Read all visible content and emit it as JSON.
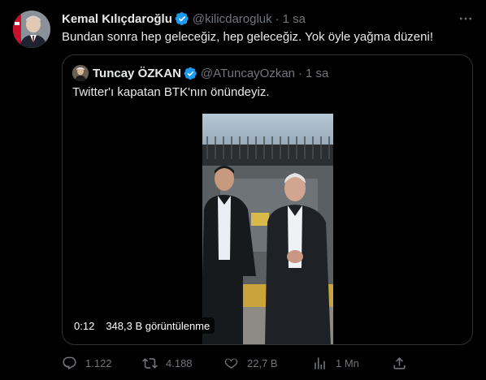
{
  "tweet": {
    "author_name": "Kemal Kılıçdaroğlu",
    "author_handle": "@kilicdarogluk",
    "separator": "·",
    "time": "1 sa",
    "text": "Bundan sonra hep geleceğiz, hep geleceğiz. Yok öyle yağma düzeni!"
  },
  "quoted": {
    "author_name": "Tuncay ÖZKAN",
    "author_handle": "@ATuncayOzkan",
    "separator": "·",
    "time": "1 sa",
    "text": "Twitter'ı kapatan BTK'nın önündeyiz.",
    "video": {
      "duration": "0:12",
      "views": "348,3 B görüntülenme"
    }
  },
  "actions": {
    "reply_count": "1.122",
    "retweet_count": "4.188",
    "like_count": "22,7 B",
    "view_count": "1 Mn"
  },
  "colors": {
    "background": "#000000",
    "text": "#e7e9ea",
    "muted": "#71767b",
    "verified": "#1d9bf0",
    "border": "#2f3336"
  },
  "icons": [
    "verified-badge-icon",
    "more-icon",
    "reply-icon",
    "retweet-icon",
    "like-icon",
    "views-icon",
    "share-icon"
  ]
}
